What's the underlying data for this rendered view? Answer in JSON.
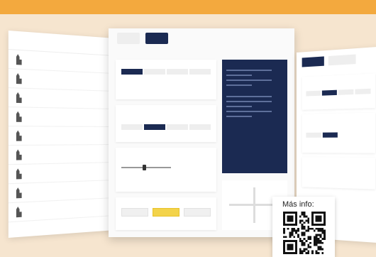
{
  "left_panel": {
    "rows": [
      {},
      {},
      {},
      {},
      {},
      {},
      {},
      {},
      {}
    ]
  },
  "center_panel": {
    "tabs": [
      {
        "active": false
      },
      {
        "active": true
      }
    ],
    "slider_value": 0.45
  },
  "right_panel": {
    "tabs": [
      {
        "active": true
      },
      {
        "active": false
      }
    ]
  },
  "info_card": {
    "label": "Más info:"
  },
  "colors": {
    "top_bar": "#f3a93e",
    "navy": "#1b2a52",
    "background": "#f6e5cf",
    "highlight": "#f3d34a"
  }
}
